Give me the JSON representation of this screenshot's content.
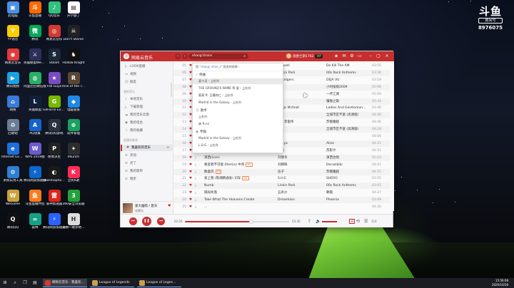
{
  "desktop_icons": [
    {
      "label": "此电脑",
      "color": "#4a90e2",
      "glyph": "▣"
    },
    {
      "label": "斗鱼直播",
      "color": "#ff6a00",
      "glyph": "斗"
    },
    {
      "label": "QQ音乐",
      "color": "#31c27c",
      "glyph": "♪"
    },
    {
      "label": "开学题了",
      "color": "#ffffff",
      "glyph": "▤"
    },
    {
      "label": "YY语音",
      "color": "#ffcc00",
      "glyph": "Y"
    },
    {
      "label": "腾讯",
      "color": "#00aa55",
      "glyph": "微"
    },
    {
      "label": "网易云音乐",
      "color": "#d33a31",
      "glyph": "◎"
    },
    {
      "label": "Don't Starve",
      "color": "#222222",
      "glyph": "☠"
    },
    {
      "label": "网易云音乐",
      "color": "#e03a3a",
      "glyph": "◉"
    },
    {
      "label": "英雄联盟WeGame版",
      "color": "#2c2f5a",
      "glyph": "⚔"
    },
    {
      "label": "Steam",
      "color": "#1b2838",
      "glyph": "S"
    },
    {
      "label": "Hollow Knight",
      "color": "#111111",
      "glyph": "♞"
    },
    {
      "label": "腾讯视频",
      "color": "#1aa1e5",
      "glyph": "▶"
    },
    {
      "label": "阿里巴巴微信版",
      "color": "#2aae67",
      "glyph": "◍"
    },
    {
      "label": "Fall Guys",
      "color": "#7a4cc2",
      "glyph": "★"
    },
    {
      "label": "Rise of the Tomb Raider",
      "color": "#5a4634",
      "glyph": "R"
    },
    {
      "label": "网络",
      "color": "#3a7bd5",
      "glyph": "⌂"
    },
    {
      "label": "英雄联盟",
      "color": "#10203a",
      "glyph": "L"
    },
    {
      "label": "GeForce Experience",
      "color": "#76b900",
      "glyph": "G"
    },
    {
      "label": "电脑管家",
      "color": "#1e88e5",
      "glyph": "◆"
    },
    {
      "label": "回收站",
      "color": "#6b7c93",
      "glyph": "♻"
    },
    {
      "label": "AQ语桌",
      "color": "#1464c8",
      "glyph": "A"
    },
    {
      "label": "腾讯QQ游戏",
      "color": "#2b3340",
      "glyph": "Q"
    },
    {
      "label": "软件管理",
      "color": "#19a15f",
      "glyph": "⊕"
    },
    {
      "label": "Internet Explorer",
      "color": "#1e6fd9",
      "glyph": "e"
    },
    {
      "label": "WPS 2019版",
      "color": "#6a5acd",
      "glyph": "W"
    },
    {
      "label": "绝地求生",
      "color": "#222222",
      "glyph": "P"
    },
    {
      "label": "Paunch",
      "color": "#2d2d2d",
      "glyph": "✦"
    },
    {
      "label": "系统实用工具",
      "color": "#2f7fd1",
      "glyph": "⚙"
    },
    {
      "label": "腾讯网游加速器",
      "color": "#0c66cc",
      "glyph": "⚡"
    },
    {
      "label": "Phasmophobia",
      "color": "#1a1a1a",
      "glyph": "◐"
    },
    {
      "label": "全民K歌",
      "color": "#ff2d55",
      "glyph": "K"
    },
    {
      "label": "WeGame",
      "color": "#c9a43a",
      "glyph": "W"
    },
    {
      "label": "斗鱼直播伴侣",
      "color": "#ff7a1a",
      "glyph": "鱼"
    },
    {
      "label": "雷神加速器",
      "color": "#e0241b",
      "glyph": "雷"
    },
    {
      "label": "360安全浏览器",
      "color": "#24a13a",
      "glyph": "3"
    },
    {
      "label": "腾讯QQ",
      "color": "#111111",
      "glyph": "Q"
    },
    {
      "label": "森林",
      "color": "#16a085",
      "glyph": "∞"
    },
    {
      "label": "腾讯网游加速器",
      "color": "#2962ff",
      "glyph": "⚡"
    },
    {
      "label": "人類一敗涂地 Human Fall",
      "color": "#dcdcdc",
      "glyph": "H"
    }
  ],
  "douyu": {
    "logo": "斗鱼",
    "sub": "房间号",
    "room": "8976075"
  },
  "music": {
    "app_name": "网易云音乐",
    "search_value": "shang'shans",
    "user_name": "盖欧兰斯1762",
    "vip": "VIP",
    "sidebar": {
      "items": [
        {
          "label": "LOOK直播",
          "icon": "▷"
        },
        {
          "label": "视频",
          "icon": "▭"
        },
        {
          "label": "朋友",
          "icon": "☺"
        }
      ],
      "section_mine": "我的音乐",
      "mine_items": [
        {
          "label": "本地音乐",
          "icon": "♪"
        },
        {
          "label": "下载管理",
          "icon": "⤓"
        },
        {
          "label": "我的音乐云盘",
          "icon": "☁"
        },
        {
          "label": "我的电台",
          "icon": "◉"
        },
        {
          "label": "我的收藏",
          "icon": "☆"
        }
      ],
      "section_created": "创建的歌单",
      "created_items": [
        {
          "label": "我喜欢的音乐",
          "icon": "♥",
          "active": true
        },
        {
          "label": "英语",
          "icon": "≡"
        },
        {
          "label": "老了",
          "icon": "≡"
        },
        {
          "label": "我的歌单",
          "icon": "≡"
        },
        {
          "label": "跑步",
          "icon": "≡"
        }
      ]
    },
    "now_playing": {
      "title": "爱大幽暗 / 轰天",
      "artist": "说聊玩"
    },
    "suggest": {
      "header_prefix": "搜 “",
      "header_query": "shang' shan_s",
      "header_suffix": "” 相关的结果 ›",
      "cat_single": "单曲",
      "single_items": [
        "爱十月 - 上杉升",
        "THE GROUND'S NAME 等 爱 - 上杉升",
        "菊葵 ft. 日暮和仁 - 上杉升",
        "Madrid in the Galaxy - 上杉升"
      ],
      "cat_artist": "歌手",
      "artist_items": [
        "上杉升",
        "赤 ft.nn"
      ],
      "cat_album": "专辑",
      "album_items": [
        "Madrid in the Galaxy - 上杉升",
        "L.O.G - 上杉升"
      ]
    },
    "songs": [
      {
        "num": "05",
        "title": "",
        "tag": "",
        "artist": "ramsell",
        "album": "Do Kill The AM",
        "dur": "03:55"
      },
      {
        "num": "06",
        "title": "",
        "tag": "",
        "artist": "Linkin Park",
        "album": "00s Rock Anthems",
        "dur": "03:36"
      },
      {
        "num": "07",
        "title": "",
        "tag": "",
        "artist": "e Rodgers",
        "album": "DEJA VU",
        "dur": "03:18"
      },
      {
        "num": "08",
        "title": "",
        "tag": "",
        "artist": "",
        "album": "小时候搞2009",
        "dur": "05:06"
      },
      {
        "num": "09",
        "title": "",
        "tag": "",
        "artist": "",
        "album": "一坏江湖",
        "dur": "05:09"
      },
      {
        "num": "10",
        "title": "",
        "tag": "",
        "artist": "",
        "album": "懂盎之歌",
        "dur": "03:34"
      },
      {
        "num": "11",
        "title": "",
        "tag": "",
        "artist": "Kings Mcfeati",
        "album": "Ladies And Gentleman...",
        "dur": "03:46"
      },
      {
        "num": "12",
        "title": "",
        "tag": "",
        "artist": "",
        "album": "全城市区不富 (高清版)",
        "dur": "04:30"
      },
      {
        "num": "13",
        "title": "",
        "tag": "",
        "artist": "金 / 李俊伟",
        "album": "苏俄瞳越",
        "dur": "04:46"
      },
      {
        "num": "14",
        "title": "",
        "tag": "",
        "artist": "",
        "album": "全城市区不富 (高清版)",
        "dur": "04:28"
      },
      {
        "num": "15",
        "title": "",
        "tag": "",
        "artist": "",
        "album": "",
        "dur": "04:06"
      },
      {
        "num": "16",
        "title": "",
        "tag": "",
        "artist": "Vonya",
        "album": "Alive",
        "dur": "04:21"
      },
      {
        "num": "17",
        "title": "金属耳朵",
        "tag": "SQ",
        "artist": "伍佰",
        "album": "苏影计",
        "dur": "04:51"
      },
      {
        "num": "18",
        "title": "演西(Live)",
        "tag": "",
        "artist": "刘德华",
        "album": "演西合唱",
        "dur": "05:03"
      },
      {
        "num": "19",
        "title": "要变者不可能 (Remix) 中英",
        "tag": "MV",
        "artist": "刘朝晖",
        "album": "Derazibibi",
        "dur": "04:01"
      },
      {
        "num": "20",
        "title": "数喜风",
        "tag": "SQ",
        "artist": "任子",
        "album": "苏俄瞳越",
        "dur": "04:25"
      },
      {
        "num": "21",
        "title": "爱上我 (铁潮精通发) 刘军",
        "tag": "MV",
        "artist": "S.H.E",
        "album": "SHERO",
        "dur": "03:55"
      },
      {
        "num": "22",
        "title": "Numb",
        "tag": "",
        "artist": "Linkin Park",
        "album": "00s Rock Anthems",
        "dur": "03:05"
      },
      {
        "num": "23",
        "title": "隔局失落",
        "tag": "",
        "artist": "五条沙",
        "album": "朝霞",
        "dur": "04:27"
      },
      {
        "num": "24",
        "title": "Take What The Heavens Create",
        "tag": "",
        "artist": "Dreamlass",
        "album": "Phoenix",
        "dur": "03:49"
      },
      {
        "num": "25",
        "title": "…",
        "tag": "",
        "artist": "",
        "album": "",
        "dur": "04:30"
      }
    ],
    "player": {
      "elapsed": "02:26",
      "total": "03:36",
      "progress": 0.64,
      "volume": 0.8,
      "lyric": "词",
      "count": "114"
    }
  },
  "taskbar": {
    "apps": [
      {
        "label": "網易云音乐 - 我喜欢...",
        "color": "#d33a31",
        "active": true
      },
      {
        "label": "League of Legends",
        "color": "#c8a050",
        "active": false
      },
      {
        "label": "League of Legen...",
        "color": "#c8a050",
        "active": false
      }
    ],
    "time": "15:56:08",
    "date": "2020/10/28"
  }
}
